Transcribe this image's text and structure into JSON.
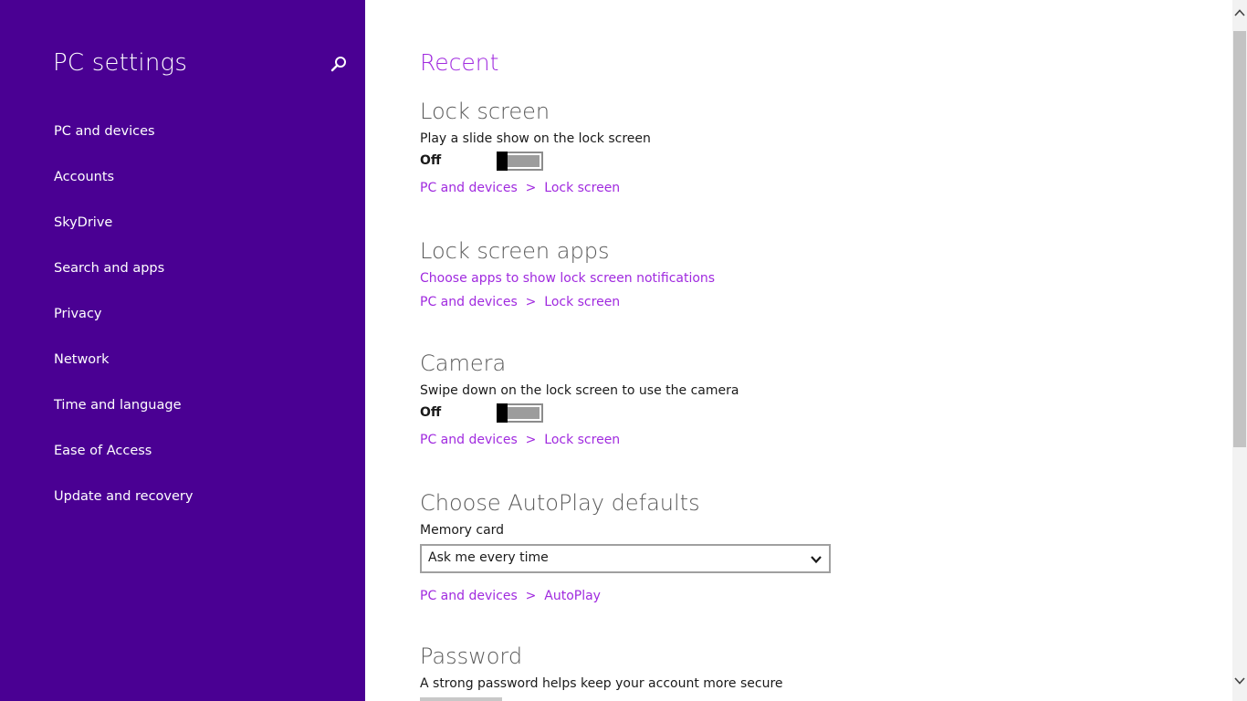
{
  "sidebar": {
    "title": "PC settings",
    "search_icon": "search-icon",
    "items": [
      {
        "label": "PC and devices"
      },
      {
        "label": "Accounts"
      },
      {
        "label": "SkyDrive"
      },
      {
        "label": "Search and apps"
      },
      {
        "label": "Privacy"
      },
      {
        "label": "Network"
      },
      {
        "label": "Time and language"
      },
      {
        "label": "Ease of Access"
      },
      {
        "label": "Update and recovery"
      }
    ]
  },
  "main": {
    "title": "Recent",
    "sections": {
      "lock_screen": {
        "heading": "Lock screen",
        "description": "Play a slide show on the lock screen",
        "toggle_state": "Off",
        "link": "PC and devices  >  Lock screen"
      },
      "lock_screen_apps": {
        "heading": "Lock screen apps",
        "action_link": "Choose apps to show lock screen notifications",
        "link": "PC and devices  >  Lock screen"
      },
      "camera": {
        "heading": "Camera",
        "description": "Swipe down on the lock screen to use the camera",
        "toggle_state": "Off",
        "link": "PC and devices  >  Lock screen"
      },
      "autoplay": {
        "heading": "Choose AutoPlay defaults",
        "field_label": "Memory card",
        "selected_option": "Ask me every time",
        "link": "PC and devices  >  AutoPlay"
      },
      "password": {
        "heading": "Password",
        "description": "A strong password helps keep your account more secure"
      }
    }
  },
  "colors": {
    "sidebar_bg": "#4a0093",
    "accent": "#a02adf",
    "heading": "#5a5a5a"
  }
}
